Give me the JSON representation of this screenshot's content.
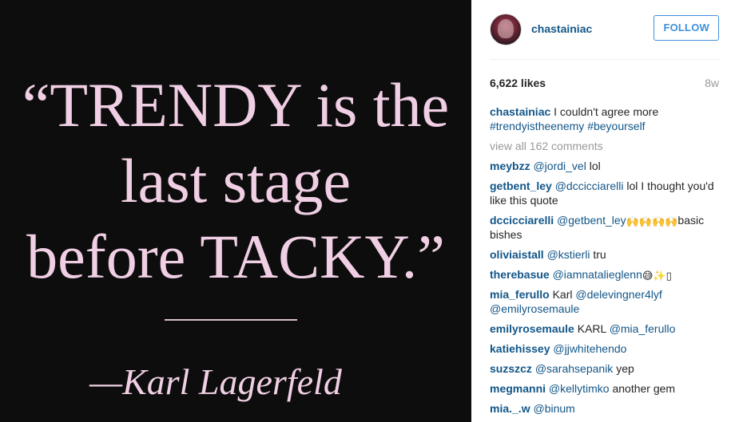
{
  "image": {
    "quote_line1": "“TRENDY is the",
    "quote_line2": "last stage",
    "quote_line3": "before TACKY.”",
    "author": "—Karl Lagerfeld"
  },
  "header": {
    "username": "chastainiac",
    "follow_label": "FOLLOW"
  },
  "stats": {
    "likes": "6,622 likes",
    "time_ago": "8w"
  },
  "caption": {
    "user": "chastainiac",
    "text": "I couldn't agree more",
    "hashtag1": "#trendyistheenemy",
    "hashtag2": "#beyourself"
  },
  "view_all": "view all 162 comments",
  "comments": [
    {
      "user": "meybzz",
      "mention": "@jordi_vel",
      "text": " lol"
    },
    {
      "user": "getbent_ley",
      "mention": "@dccicciarelli",
      "text": " lol I thought you'd like this quote"
    },
    {
      "user": "dccicciarelli",
      "mention": "@getbent_ley",
      "emoji": "🙌🙌🙌🙌",
      "text": "basic bishes"
    },
    {
      "user": "oliviaistall",
      "mention": "@kstierli",
      "text": " tru"
    },
    {
      "user": "therebasue",
      "mention": "@iamnatalieglenn",
      "emoji": " 😅✨▯",
      "text": ""
    },
    {
      "user": "mia_ferullo",
      "pre": " Karl ",
      "mention": "@delevingner4lyf",
      "mention2": "@emilyrosemaule",
      "text": ""
    },
    {
      "user": "emilyrosemaule",
      "pre": " KARL ",
      "mention": "@mia_ferullo",
      "text": ""
    },
    {
      "user": "katiehissey",
      "mention": "@jjwhitehendo",
      "text": ""
    },
    {
      "user": "suzszcz",
      "mention": "@sarahsepanik",
      "text": " yep"
    },
    {
      "user": "megmanni",
      "mention": "@kellytimko",
      "text": " another gem"
    },
    {
      "user": "mia._.w",
      "mention": "@binum",
      "text": ""
    }
  ],
  "colors": {
    "link": "#125688",
    "follow": "#4090db",
    "quote_pink": "#f0cfe4",
    "image_bg": "#0d0d0d"
  }
}
